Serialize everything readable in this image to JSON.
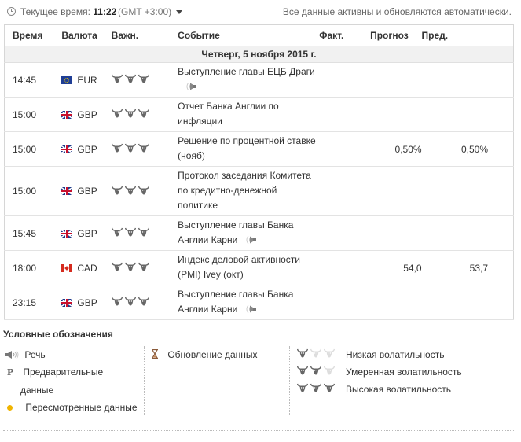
{
  "header": {
    "time_label": "Текущее время:",
    "time_value": "11:22",
    "timezone": "(GMT +3:00)",
    "notice": "Все данные активны и обновляются автоматически."
  },
  "columns": {
    "time": "Время",
    "currency": "Валюта",
    "importance": "Важн.",
    "event": "Событие",
    "actual": "Факт.",
    "forecast": "Прогноз",
    "previous": "Пред."
  },
  "date_row": "Четверг, 5 ноября 2015 г.",
  "rows": [
    {
      "time": "14:45",
      "flag": "eur",
      "currency": "EUR",
      "level": 3,
      "event_lines": [
        "Выступление главы ЕЦБ Драги"
      ],
      "speech": true,
      "actual": "",
      "forecast": "",
      "previous": ""
    },
    {
      "time": "15:00",
      "flag": "gbp",
      "currency": "GBP",
      "level": 3,
      "event_lines": [
        "Отчет Банка Англии по",
        "инфляции"
      ],
      "speech": false,
      "actual": "",
      "forecast": "",
      "previous": ""
    },
    {
      "time": "15:00",
      "flag": "gbp",
      "currency": "GBP",
      "level": 3,
      "event_lines": [
        "Решение по процентной ставке",
        "(нояб)"
      ],
      "speech": false,
      "actual": "",
      "forecast": "0,50%",
      "previous": "0,50%"
    },
    {
      "time": "15:00",
      "flag": "gbp",
      "currency": "GBP",
      "level": 3,
      "event_lines": [
        "Протокол заседания Комитета",
        "по кредитно-денежной",
        "политике"
      ],
      "speech": false,
      "actual": "",
      "forecast": "",
      "previous": ""
    },
    {
      "time": "15:45",
      "flag": "gbp",
      "currency": "GBP",
      "level": 3,
      "event_lines": [
        "Выступление главы Банка",
        "Англии Карни"
      ],
      "speech": true,
      "actual": "",
      "forecast": "",
      "previous": ""
    },
    {
      "time": "18:00",
      "flag": "cad",
      "currency": "CAD",
      "level": 3,
      "event_lines": [
        "Индекс деловой активности",
        "(PMI) Ivey (окт)"
      ],
      "speech": false,
      "actual": "",
      "forecast": "54,0",
      "previous": "53,7"
    },
    {
      "time": "23:15",
      "flag": "gbp",
      "currency": "GBP",
      "level": 3,
      "event_lines": [
        "Выступление главы Банка",
        "Англии Карни"
      ],
      "speech": true,
      "actual": "",
      "forecast": "",
      "previous": ""
    }
  ],
  "legend": {
    "title": "Условные обозначения",
    "speech": "Речь",
    "preliminary_line1": "Предварительные",
    "preliminary_line2": "данные",
    "revised": "Пересмотренные данные",
    "update": "Обновление данных",
    "low": "Низкая волатильность",
    "medium": "Умеренная волатильность",
    "high": "Высокая волатильность"
  },
  "colors": {
    "bull_on": "#666666",
    "bull_off": "#dddddd",
    "revised_dot": "#f0b400"
  },
  "icons": {
    "clock": "clock-icon",
    "bull": "bull-icon",
    "speech": "speaker-icon",
    "hourglass": "hourglass-icon"
  }
}
